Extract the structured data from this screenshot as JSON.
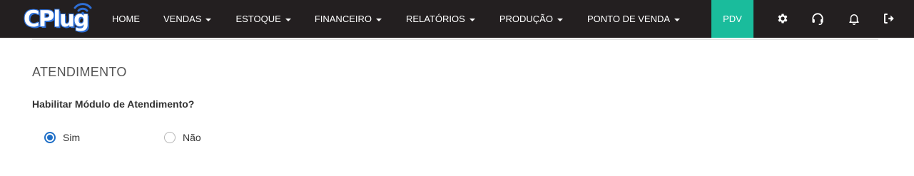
{
  "brand": {
    "logo_text": "CPlug"
  },
  "nav": {
    "items": [
      {
        "label": "HOME",
        "has_dropdown": false
      },
      {
        "label": "VENDAS",
        "has_dropdown": true
      },
      {
        "label": "ESTOQUE",
        "has_dropdown": true
      },
      {
        "label": "FINANCEIRO",
        "has_dropdown": true
      },
      {
        "label": "RELATÓRIOS",
        "has_dropdown": true
      },
      {
        "label": "PRODUÇÃO",
        "has_dropdown": true
      },
      {
        "label": "PONTO DE VENDA",
        "has_dropdown": true
      }
    ],
    "pdv_label": "PDV",
    "icons": [
      "gear-icon",
      "headset-icon",
      "bell-icon",
      "logout-icon"
    ],
    "pdv_color": "#1abc9c",
    "bar_color": "#231f20"
  },
  "section": {
    "title": "ATENDIMENTO",
    "question": "Habilitar Módulo de Atendimento?",
    "options": [
      {
        "label": "Sim",
        "checked": true
      },
      {
        "label": "Não",
        "checked": false
      }
    ]
  }
}
